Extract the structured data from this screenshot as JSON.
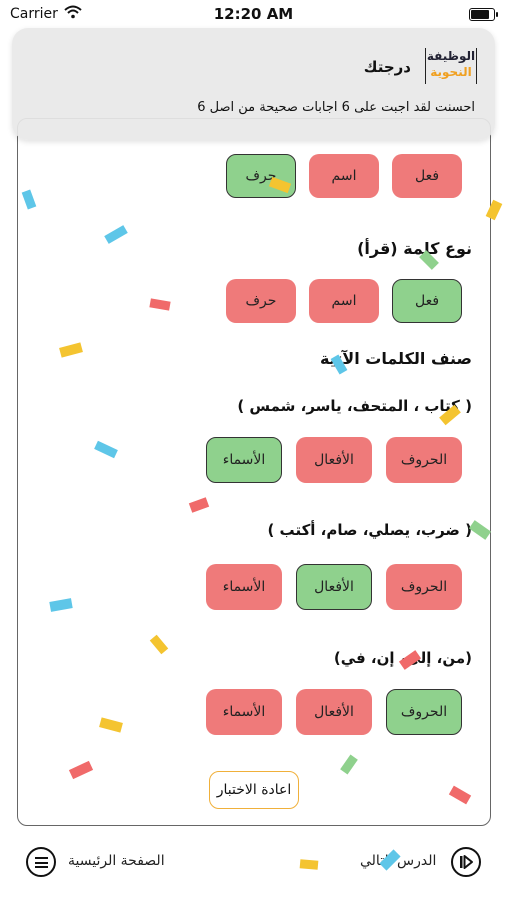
{
  "status_bar": {
    "carrier": "Carrier",
    "time": "12:20 AM",
    "battery_level": 0.9
  },
  "notification": {
    "logo_line1": "الوظيفة",
    "logo_line2": "النحوية",
    "title": "درجتك",
    "message": "احسنت لقد اجبت على 6 اجابات صحيحة من اصل 6"
  },
  "questions": [
    {
      "options": [
        {
          "label": "فعل",
          "correct": false
        },
        {
          "label": "اسم",
          "correct": false
        },
        {
          "label": "حرف",
          "correct": true
        }
      ]
    },
    {
      "title": "نوع كلمة (قرأ)",
      "options": [
        {
          "label": "فعل",
          "correct": true
        },
        {
          "label": "اسم",
          "correct": false
        },
        {
          "label": "حرف",
          "correct": false
        }
      ]
    }
  ],
  "classify": {
    "title": "صنف الكلمات الآتية",
    "groups": [
      {
        "words": "( كتاب ، المتحف، ياسر، شمس )",
        "options": [
          {
            "label": "الحروف",
            "correct": false
          },
          {
            "label": "الأفعال",
            "correct": false
          },
          {
            "label": "الأسماء",
            "correct": true
          }
        ]
      },
      {
        "words": "( ضرب، يصلي، صام، أكتب )",
        "options": [
          {
            "label": "الحروف",
            "correct": false
          },
          {
            "label": "الأفعال",
            "correct": true
          },
          {
            "label": "الأسماء",
            "correct": false
          }
        ]
      },
      {
        "words": "(من، إلى، إن، في)",
        "options": [
          {
            "label": "الحروف",
            "correct": true
          },
          {
            "label": "الأفعال",
            "correct": false
          },
          {
            "label": "الأسماء",
            "correct": false
          }
        ]
      }
    ]
  },
  "retry_label": "اعادة الاختبار",
  "bottom_bar": {
    "home_label": "الصفحة الرئيسية",
    "next_label": "الدرس التالي"
  },
  "colors": {
    "correct": "#8fd18d",
    "wrong": "#ef7a7a",
    "retry_border": "#f0b03a"
  },
  "icons": {
    "menu": "hamburger-menu-icon",
    "next": "next-lesson-icon",
    "wifi": "wifi-icon",
    "battery": "battery-icon"
  }
}
